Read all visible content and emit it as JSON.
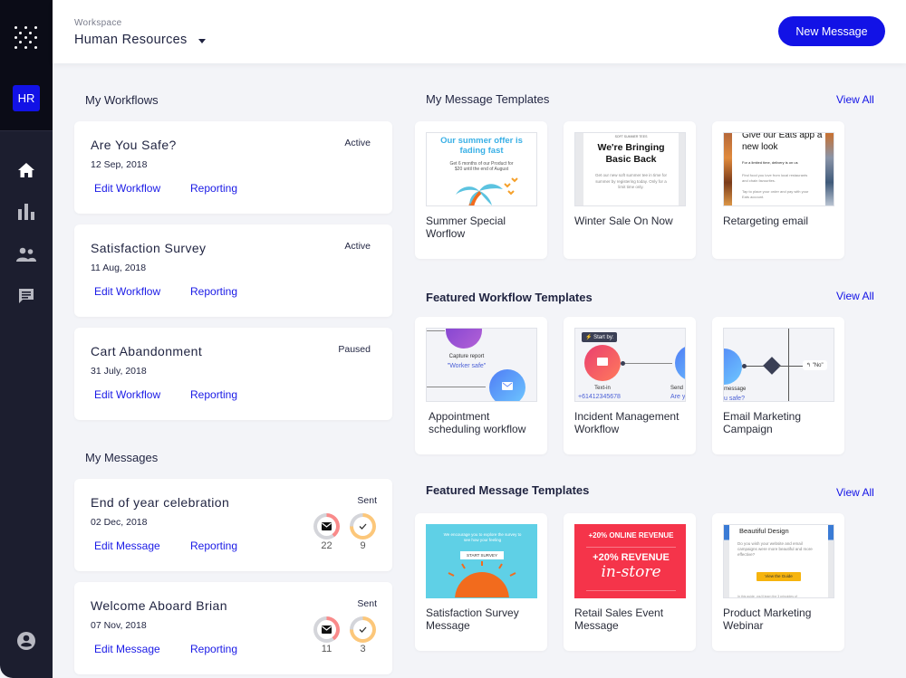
{
  "sidebar": {
    "logo_icon": "dot-grid-logo-icon",
    "workspace_badge": "HR",
    "nav": [
      {
        "name": "home",
        "icon": "home-icon",
        "active": true
      },
      {
        "name": "analytics",
        "icon": "bar-chart-icon",
        "active": false
      },
      {
        "name": "people",
        "icon": "people-icon",
        "active": false
      },
      {
        "name": "messages",
        "icon": "chat-icon",
        "active": false
      }
    ],
    "profile_icon": "account-circle-icon"
  },
  "header": {
    "workspace_label": "Workspace",
    "workspace_name": "Human Resources",
    "new_message_label": "New Message"
  },
  "my_workflows": {
    "title": "My Workflows",
    "items": [
      {
        "title": "Are You Safe?",
        "date": "12 Sep, 2018",
        "status": "Active",
        "edit_label": "Edit Workflow",
        "report_label": "Reporting"
      },
      {
        "title": "Satisfaction Survey",
        "date": "11 Aug, 2018",
        "status": "Active",
        "edit_label": "Edit Workflow",
        "report_label": "Reporting"
      },
      {
        "title": "Cart Abandonment",
        "date": "31 July, 2018",
        "status": "Paused",
        "edit_label": "Edit Workflow",
        "report_label": "Reporting"
      }
    ]
  },
  "my_messages": {
    "title": "My Messages",
    "items": [
      {
        "title": "End of year celebration",
        "date": "02 Dec, 2018",
        "status": "Sent",
        "edit_label": "Edit Message",
        "report_label": "Reporting",
        "sent_count": "22",
        "read_count": "9",
        "sent_fraction": 0.4,
        "read_fraction": 0.75
      },
      {
        "title": "Welcome Aboard Brian",
        "date": "07 Nov, 2018",
        "status": "Sent",
        "edit_label": "Edit Message",
        "report_label": "Reporting",
        "sent_count": "11",
        "read_count": "3",
        "sent_fraction": 0.4,
        "read_fraction": 0.75
      }
    ]
  },
  "message_templates": {
    "title": "My Message Templates",
    "view_all": "View All",
    "items": [
      {
        "label": "Summer Special Worflow",
        "thumb": {
          "heading": "Our summer offer is fading fast",
          "body": "Get 6 months of our Product for $20 until the end of August"
        }
      },
      {
        "label": "Winter Sale On Now",
        "thumb": {
          "kicker": "SOFT SUMMER TEES",
          "heading": "We're Bringing Basic Back",
          "body": "Get our new soft summer tee in time for summer by registering today. Only for a limit time only."
        }
      },
      {
        "label": "Retargeting email",
        "thumb": {
          "heading": "Give our Eats app a new look",
          "sub": "For a limited time, delivery is on us",
          "body1": "Find food you love from local restaurants and chain favourites.",
          "body2": "Tap to place your order and pay with your Eats account."
        }
      }
    ]
  },
  "workflow_templates": {
    "title": "Featured Workflow Templates",
    "view_all": "View All",
    "items": [
      {
        "label": "Appointment scheduling workflow",
        "thumb": {
          "step": "Capture report",
          "value": "\"Worker safe\""
        }
      },
      {
        "label": "Incident Management Workflow",
        "thumb": {
          "badge": "Start by:",
          "step": "Text-in",
          "value": "+61412345678",
          "step2": "Send",
          "value2": "Are y"
        }
      },
      {
        "label": "Email Marketing Campaign",
        "thumb": {
          "step": "message",
          "value": "u safe?",
          "branch": "\"No\""
        }
      }
    ]
  },
  "featured_messages": {
    "title": "Featured Message Templates",
    "view_all": "View All",
    "items": [
      {
        "label": "Satisfaction Survey Message",
        "thumb": {
          "body": "We encourage you to explore the survey to see how your feeling",
          "button": "START SURVEY"
        }
      },
      {
        "label": "Retail Sales Event Message",
        "thumb": {
          "line1": "+20% ONLINE REVENUE",
          "line2": "+20% REVENUE",
          "line3": "in-store"
        }
      },
      {
        "label": "Product Marketing Webinar",
        "thumb": {
          "heading": "Beautiful Design",
          "body": "Do you wish your website and email campaigns were more beautiful and more effective?",
          "button": "View the Guide",
          "footer": "In this guide, you'll learn the 3 principles of"
        }
      }
    ]
  },
  "colors": {
    "accent": "#1212e6",
    "sidebar": "#1c1e2f",
    "ring_sent": "#f98a8a",
    "ring_read": "#fcc77a"
  }
}
